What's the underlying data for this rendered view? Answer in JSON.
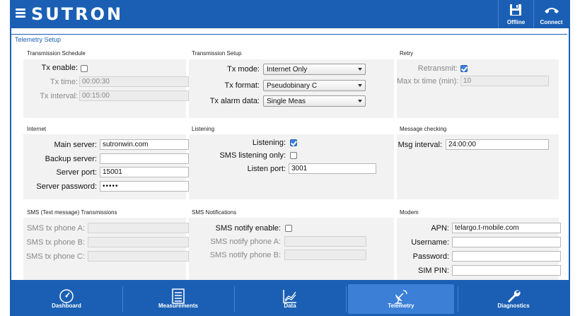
{
  "app": {
    "brand": "SUTRON"
  },
  "header": {
    "offline_label": "Offline",
    "connect_label": "Connect"
  },
  "page": {
    "title": "Telemetry Setup"
  },
  "transmission_schedule": {
    "title": "Transmission Schedule",
    "tx_enable_label": "Tx enable:",
    "tx_enable_checked": false,
    "tx_time_label": "Tx time:",
    "tx_time_value": "00:00:30",
    "tx_interval_label": "Tx interval:",
    "tx_interval_value": "00:15:00"
  },
  "transmission_setup": {
    "title": "Transmission Setup",
    "tx_mode_label": "Tx mode:",
    "tx_mode_value": "Internet Only",
    "tx_format_label": "Tx format:",
    "tx_format_value": "Pseudobinary C",
    "tx_alarm_label": "Tx alarm data:",
    "tx_alarm_value": "Single Meas"
  },
  "retry": {
    "title": "Retry",
    "retransmit_label": "Retransmit:",
    "retransmit_checked": true,
    "max_tx_time_label": "Max tx time (min):",
    "max_tx_time_value": "10"
  },
  "internet": {
    "title": "Internet",
    "main_server_label": "Main server:",
    "main_server_value": "sutronwin.com",
    "backup_server_label": "Backup server:",
    "backup_server_value": "",
    "server_port_label": "Server port:",
    "server_port_value": "15001",
    "server_password_label": "Server password:",
    "server_password_value": "•••••"
  },
  "listening": {
    "title": "Listening",
    "listening_label": "Listening:",
    "listening_checked": true,
    "sms_only_label": "SMS listening only:",
    "sms_only_checked": false,
    "listen_port_label": "Listen port:",
    "listen_port_value": "3001"
  },
  "message_checking": {
    "title": "Message checking",
    "msg_interval_label": "Msg interval:",
    "msg_interval_value": "24:00:00"
  },
  "sms_tx": {
    "title": "SMS (Text message) Transmissions",
    "phone_a_label": "SMS tx phone A:",
    "phone_b_label": "SMS tx phone B:",
    "phone_c_label": "SMS tx phone C:"
  },
  "sms_notifications": {
    "title": "SMS Notifications",
    "notify_enable_label": "SMS notify enable:",
    "notify_enable_checked": false,
    "notify_phone_a_label": "SMS notify phone A:",
    "notify_phone_b_label": "SMS notify phone B:"
  },
  "modem": {
    "title": "Modem",
    "apn_label": "APN:",
    "apn_value": "telargo.t-mobile.com",
    "username_label": "Username:",
    "password_label": "Password:",
    "sim_pin_label": "SIM PIN:"
  },
  "nav": {
    "items": [
      {
        "label": "Dashboard",
        "icon": "gauge-icon"
      },
      {
        "label": "Measurements",
        "icon": "list-icon"
      },
      {
        "label": "Data",
        "icon": "chart-icon"
      },
      {
        "label": "Telemetry",
        "icon": "satellite-dish-icon"
      },
      {
        "label": "Diagnostics",
        "icon": "wrench-icon"
      }
    ],
    "active_index": 3
  },
  "colors": {
    "brand_blue": "#1a5fb4",
    "active_tab": "#3b7fd6",
    "panel_bg": "#f2f2f2"
  }
}
